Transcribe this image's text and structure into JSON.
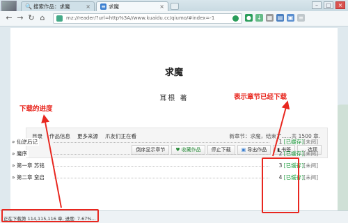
{
  "browser": {
    "tabs": [
      {
        "icon": "search-icon",
        "label": "搜索作品：求魔"
      },
      {
        "icon": "book-icon",
        "label": "求魔"
      }
    ],
    "address": "mz://reader/?url=http%3A//www.kuaidu.cc/qiumo/#index=-1"
  },
  "page": {
    "title": "求魔",
    "author": "耳根 著",
    "nav_links": [
      "目录",
      "作品信息",
      "更多来源",
      "爪友们正在看"
    ],
    "latest_chapter": "新章节：求魔，结束了......共 1500 章.",
    "buttons": {
      "reverse": "倒序显示章节",
      "favorite": "收藏作品",
      "stop": "停止下载",
      "export": "导出作品",
      "bookmark": "书签",
      "options": "... 选项"
    },
    "chapters": [
      {
        "title": "» 仙逆后记",
        "index": "1",
        "cache": "[已缓存]",
        "read": "[未阅]"
      },
      {
        "title": "» 魔序",
        "index": "2",
        "cache": "[已缓存]",
        "read": "[未阅]"
      },
      {
        "title": "» 第一章 苏铭",
        "index": "3",
        "cache": "[已缓存]",
        "read": "[未阅]"
      },
      {
        "title": "» 第二章 蛮启",
        "index": "4",
        "cache": "[已缓存]",
        "read": "[未阅]"
      }
    ]
  },
  "status": {
    "text": "正在下载第 114,115,116 章, 进度: 7.67%..."
  },
  "annotations": {
    "progress_label": "下载的进度",
    "cached_label": "表示章节已经下载"
  },
  "colors": {
    "annotation": "#e8271f",
    "cached": "#1a9a3a"
  }
}
